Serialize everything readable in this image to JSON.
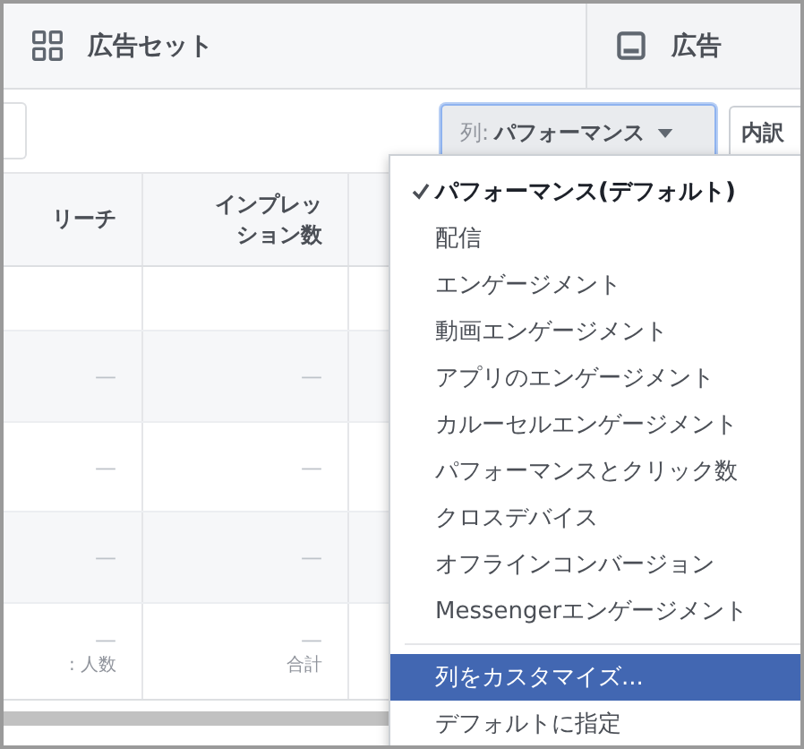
{
  "tabs": [
    {
      "label": "広告セット",
      "kind": "grid",
      "selected": true
    },
    {
      "label": "広告",
      "kind": "ad",
      "selected": false
    }
  ],
  "toolbar": {
    "columns_button": {
      "prefix": "列:",
      "label": "パフォーマンス",
      "focused": true
    },
    "breakdown_button": "内訳"
  },
  "table": {
    "columns": [
      "リーチ",
      "インプレッション数"
    ],
    "rows": [
      {
        "cells": [
          "",
          ""
        ]
      },
      {
        "cells": [
          "—",
          "—"
        ]
      },
      {
        "cells": [
          "—",
          "—"
        ]
      },
      {
        "cells": [
          "—",
          "—"
        ]
      }
    ],
    "summary": [
      {
        "value": "—",
        "caption": ": 人数"
      },
      {
        "value": "—",
        "caption": "合計"
      }
    ]
  },
  "menu": {
    "items": [
      {
        "label": "パフォーマンス(デフォルト)",
        "selected": true,
        "highlighted": false
      },
      {
        "label": "配信",
        "selected": false,
        "highlighted": false
      },
      {
        "label": "エンゲージメント",
        "selected": false,
        "highlighted": false
      },
      {
        "label": "動画エンゲージメント",
        "selected": false,
        "highlighted": false
      },
      {
        "label": "アプリのエンゲージメント",
        "selected": false,
        "highlighted": false
      },
      {
        "label": "カルーセルエンゲージメント",
        "selected": false,
        "highlighted": false
      },
      {
        "label": "パフォーマンスとクリック数",
        "selected": false,
        "highlighted": false
      },
      {
        "label": "クロスデバイス",
        "selected": false,
        "highlighted": false
      },
      {
        "label": "オフラインコンバージョン",
        "selected": false,
        "highlighted": false
      },
      {
        "label": "Messengerエンゲージメント",
        "selected": false,
        "highlighted": false
      }
    ],
    "actions": [
      {
        "label": "列をカスタマイズ...",
        "highlighted": true
      },
      {
        "label": "デフォルトに指定",
        "highlighted": false
      }
    ]
  }
}
